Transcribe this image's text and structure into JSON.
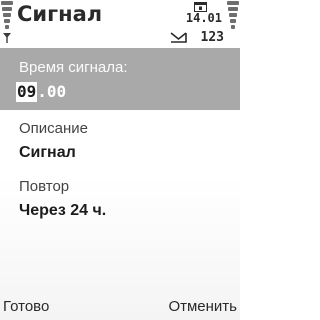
{
  "header": {
    "title": "Сигнал",
    "date": "14.01",
    "message_count": "123"
  },
  "form": {
    "alarm_time": {
      "label": "Время сигнала:",
      "hours": "09",
      "minutes": ".00"
    },
    "description": {
      "label": "Описание",
      "value": "Сигнал"
    },
    "repeat": {
      "label": "Повтор",
      "value": "Через 24 ч."
    }
  },
  "softkeys": {
    "left": "Готово",
    "right": "Отменить"
  },
  "colors": {
    "selected_row": "#a9a9a9",
    "text": "#222222",
    "indicator": "#6e6e6e"
  }
}
